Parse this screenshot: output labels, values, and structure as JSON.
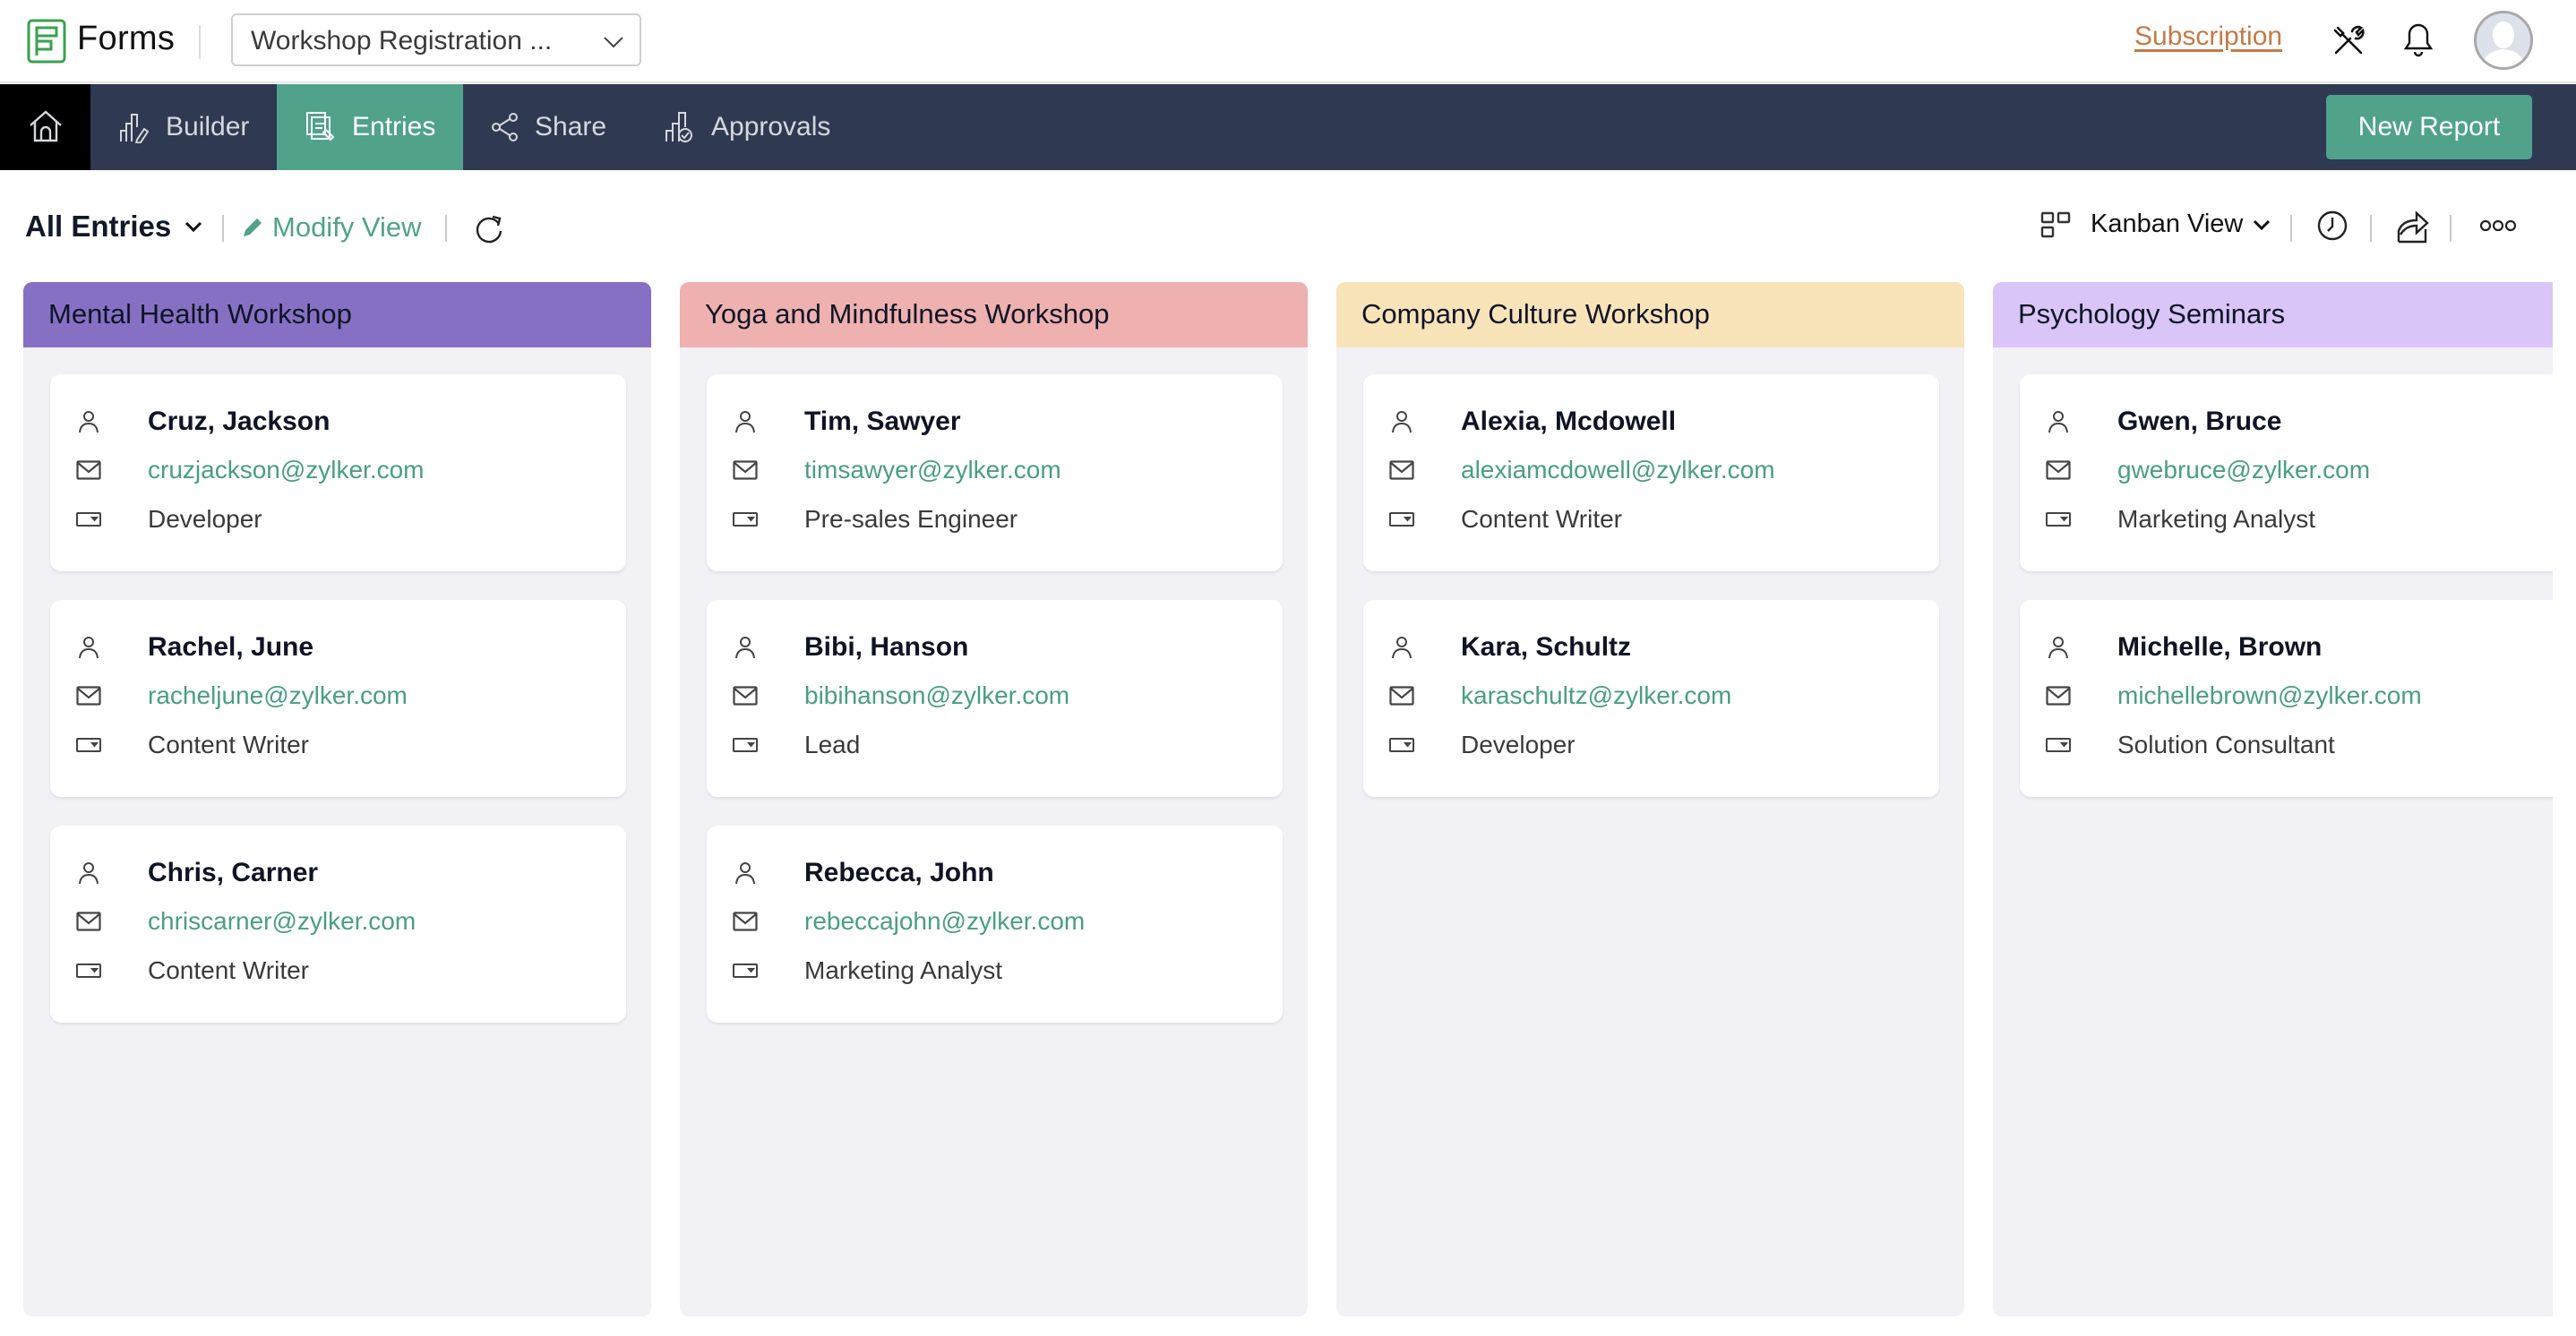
{
  "app": {
    "brand": "Forms",
    "form_selector": "Workshop Registration ...",
    "subscription_link": "Subscription",
    "icons": {
      "logo": "forms-logo-icon",
      "tools": "tools-icon",
      "notifications": "bell-icon",
      "avatar": "user-avatar"
    }
  },
  "nav": {
    "home_icon": "home-icon",
    "tabs": [
      {
        "label": "Builder",
        "icon": "builder-icon",
        "active": false
      },
      {
        "label": "Entries",
        "icon": "entries-icon",
        "active": true
      },
      {
        "label": "Share",
        "icon": "share-icon",
        "active": false
      },
      {
        "label": "Approvals",
        "icon": "approvals-icon",
        "active": false
      }
    ],
    "new_report_label": "New Report"
  },
  "toolbar": {
    "view_filter": "All Entries",
    "modify_view_label": "Modify View",
    "view_mode": "Kanban View",
    "icons": [
      "refresh-icon",
      "kanban-grid-icon",
      "clock-icon",
      "export-share-icon",
      "more-icon"
    ]
  },
  "colors": {
    "accent": "#50a28b",
    "nav_bg": "#2f3a52",
    "subscription": "#c47a46",
    "column_bg": "#f1f1f6"
  },
  "columns": [
    {
      "title": "Mental Health Workshop",
      "color": "#8670c4",
      "cards": [
        {
          "name": "Cruz, Jackson",
          "email": "cruzjackson@zylker.com",
          "role": "Developer"
        },
        {
          "name": "Rachel, June",
          "email": "racheljune@zylker.com",
          "role": "Content Writer"
        },
        {
          "name": "Chris, Carner",
          "email": "chriscarner@zylker.com",
          "role": "Content Writer"
        }
      ]
    },
    {
      "title": "Yoga and Mindfulness Workshop",
      "color": "#efb0b0",
      "cards": [
        {
          "name": "Tim, Sawyer",
          "email": "timsawyer@zylker.com",
          "role": "Pre-sales Engineer"
        },
        {
          "name": "Bibi, Hanson",
          "email": "bibihanson@zylker.com",
          "role": "Lead"
        },
        {
          "name": "Rebecca, John",
          "email": "rebeccajohn@zylker.com",
          "role": "Marketing Analyst"
        }
      ]
    },
    {
      "title": "Company Culture Workshop",
      "color": "#f9e3b9",
      "cards": [
        {
          "name": "Alexia, Mcdowell",
          "email": "alexiamcdowell@zylker.com",
          "role": "Content Writer"
        },
        {
          "name": "Kara, Schultz",
          "email": "karaschultz@zylker.com",
          "role": "Developer"
        }
      ]
    },
    {
      "title": "Psychology Seminars",
      "color": "#d9c5f8",
      "cards": [
        {
          "name": "Gwen, Bruce",
          "email": "gwebruce@zylker.com",
          "role": "Marketing Analyst"
        },
        {
          "name": "Michelle, Brown",
          "email": "michellebrown@zylker.com",
          "role": "Solution Consultant"
        }
      ]
    }
  ]
}
